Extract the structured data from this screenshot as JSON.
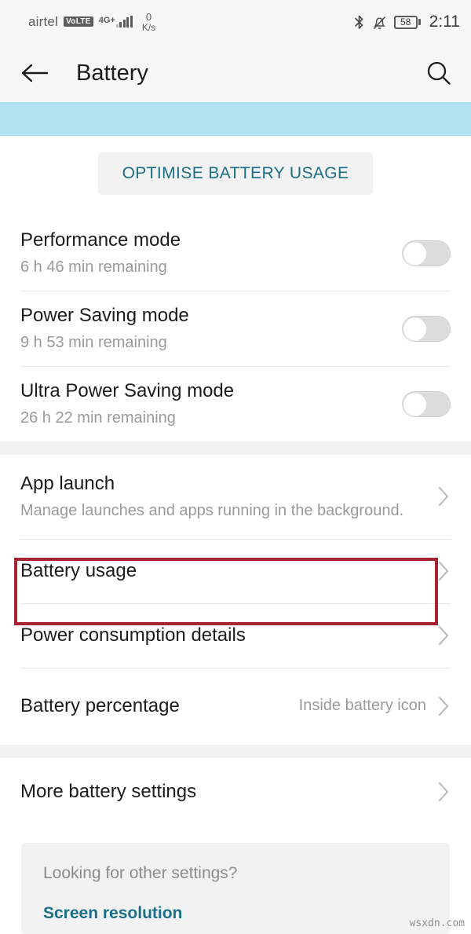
{
  "status_bar": {
    "carrier": "airtel",
    "volte_badge": "VoLTE",
    "network_type": "4G+",
    "data_speed_value": "0",
    "data_speed_unit": "K/s",
    "bluetooth_icon": "bluetooth-icon",
    "silent_icon": "bell-muted-icon",
    "battery_percent": "58",
    "time": "2:11"
  },
  "app_bar": {
    "back_icon": "back-arrow-icon",
    "title": "Battery",
    "search_icon": "search-icon"
  },
  "optimise": {
    "label": "OPTIMISE BATTERY USAGE"
  },
  "modes": [
    {
      "title": "Performance mode",
      "subtitle": "6 h 46 min remaining",
      "toggle_on": false
    },
    {
      "title": "Power Saving mode",
      "subtitle": "9 h 53 min remaining",
      "toggle_on": false
    },
    {
      "title": "Ultra Power Saving mode",
      "subtitle": "26 h 22 min remaining",
      "toggle_on": false
    }
  ],
  "settings_group": {
    "app_launch": {
      "title": "App launch",
      "subtitle": "Manage launches and apps running in the background.",
      "chevron_icon": "chevron-right-icon"
    },
    "battery_usage": {
      "title": "Battery usage",
      "chevron_icon": "chevron-right-icon",
      "highlighted": true,
      "highlight_color": "#a82331"
    },
    "power_consumption": {
      "title": "Power consumption details",
      "chevron_icon": "chevron-right-icon"
    },
    "battery_percentage": {
      "title": "Battery percentage",
      "value": "Inside battery icon",
      "chevron_icon": "chevron-right-icon"
    }
  },
  "more_group": {
    "more_battery_settings": {
      "title": "More battery settings",
      "chevron_icon": "chevron-right-icon"
    }
  },
  "bottom_card": {
    "hint": "Looking for other settings?",
    "link": "Screen resolution"
  },
  "watermark": "wsxdn.com",
  "colors": {
    "accent_teal": "#1a6f87",
    "cyan_band": "#b0e3ef",
    "annotation_red": "#a82331",
    "section_gap": "#f2f2f2"
  }
}
